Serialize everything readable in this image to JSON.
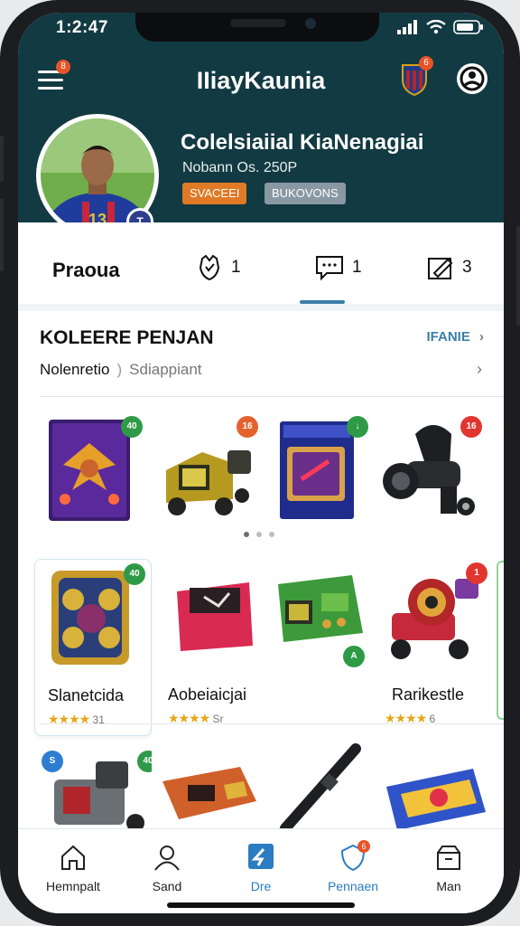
{
  "status_bar": {
    "time": "1:2:47"
  },
  "header": {
    "app_title": "IIiayKaunia",
    "menu_badge": "8",
    "crest_badge": "6"
  },
  "profile": {
    "name": "Colelsiaiial KiaNenagiai",
    "meta": "Nobann Os. 250P",
    "tags": [
      "SVACEEI",
      "BUKOVONS"
    ],
    "avatar_badge": "T"
  },
  "stats": {
    "label": "Praoua",
    "items": [
      {
        "icon": "trophy-icon",
        "value": "1"
      },
      {
        "icon": "chat-icon",
        "value": "1"
      },
      {
        "icon": "edit-icon",
        "value": "3"
      }
    ]
  },
  "collection": {
    "title": "KOLEERE PENJAN",
    "see_all": "IFANIE",
    "breadcrumb": {
      "current": "Nolenretio",
      "sub": "Sdiappiant"
    },
    "row1_badges": [
      "40",
      "16",
      "↓",
      "16"
    ],
    "row2_badges": [
      "40",
      "A",
      "1"
    ],
    "cards": [
      {
        "name": "Slanetcida",
        "rating_text": "31",
        "stars": "★★★★"
      },
      {
        "name": "Aobeiaicjai",
        "rating_text": "Sr",
        "stars": "★★★★"
      },
      {
        "name": "Rarikestle",
        "rating_text": "6",
        "stars": "★★★★"
      }
    ],
    "row3_badges": [
      "S",
      "40"
    ]
  },
  "bottom_nav": {
    "items": [
      {
        "label": "Hemnpalt",
        "icon": "home-icon"
      },
      {
        "label": "Sand",
        "icon": "person-icon"
      },
      {
        "label": "Dre",
        "icon": "bolt-icon"
      },
      {
        "label": "Pennaen",
        "icon": "shield-icon",
        "badge": "6"
      },
      {
        "label": "Man",
        "icon": "box-icon"
      }
    ]
  },
  "colors": {
    "header_bg": "#123a42",
    "accent": "#3a7fa8",
    "tag_orange": "#e07a26",
    "tag_gray": "#8a98a3",
    "badge_green": "#2e9a47",
    "badge_orange": "#e4622e",
    "active_nav": "#2b7cc2"
  }
}
